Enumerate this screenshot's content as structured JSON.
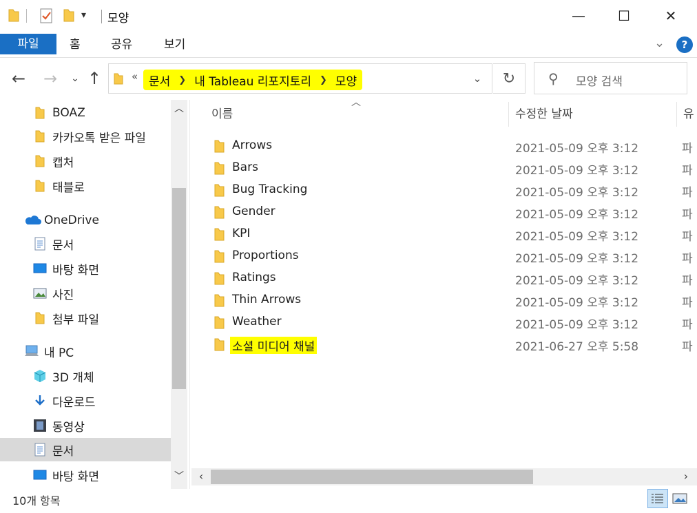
{
  "window": {
    "title": "모양",
    "minimize": "—",
    "maximize": "☐",
    "close": "✕"
  },
  "ribbon": {
    "tabs": [
      "파일",
      "홈",
      "공유",
      "보기"
    ]
  },
  "address": {
    "overflow": "«",
    "crumbs": [
      "문서",
      "내 Tableau 리포지토리",
      "모양"
    ]
  },
  "search": {
    "placeholder": "모양 검색"
  },
  "nav": {
    "items": [
      {
        "label": "BOAZ",
        "icon": "folder-icon"
      },
      {
        "label": "카카오톡 받은 파일",
        "icon": "folder-icon"
      },
      {
        "label": "캡처",
        "icon": "folder-icon"
      },
      {
        "label": "태블로",
        "icon": "folder-icon"
      },
      {
        "label": "OneDrive",
        "icon": "onedrive-cloud-icon"
      },
      {
        "label": "문서",
        "icon": "document-icon"
      },
      {
        "label": "바탕 화면",
        "icon": "desktop-icon"
      },
      {
        "label": "사진",
        "icon": "pictures-icon"
      },
      {
        "label": "첨부 파일",
        "icon": "folder-icon"
      },
      {
        "label": "내 PC",
        "icon": "this-pc-icon"
      },
      {
        "label": "3D 개체",
        "icon": "3d-objects-icon"
      },
      {
        "label": "다운로드",
        "icon": "download-icon"
      },
      {
        "label": "동영상",
        "icon": "videos-icon"
      },
      {
        "label": "문서",
        "icon": "document-icon",
        "selected": true
      },
      {
        "label": "바탕 화면",
        "icon": "desktop-icon"
      }
    ]
  },
  "columns": {
    "name": "이름",
    "modified": "수정한 날짜",
    "type": "유"
  },
  "files": [
    {
      "name": "Arrows",
      "modified": "2021-05-09 오후 3:12",
      "type": "파"
    },
    {
      "name": "Bars",
      "modified": "2021-05-09 오후 3:12",
      "type": "파"
    },
    {
      "name": "Bug Tracking",
      "modified": "2021-05-09 오후 3:12",
      "type": "파"
    },
    {
      "name": "Gender",
      "modified": "2021-05-09 오후 3:12",
      "type": "파"
    },
    {
      "name": "KPI",
      "modified": "2021-05-09 오후 3:12",
      "type": "파"
    },
    {
      "name": "Proportions",
      "modified": "2021-05-09 오후 3:12",
      "type": "파"
    },
    {
      "name": "Ratings",
      "modified": "2021-05-09 오후 3:12",
      "type": "파"
    },
    {
      "name": "Thin Arrows",
      "modified": "2021-05-09 오후 3:12",
      "type": "파"
    },
    {
      "name": "Weather",
      "modified": "2021-05-09 오후 3:12",
      "type": "파"
    },
    {
      "name": "소셜 미디어 채널",
      "modified": "2021-06-27 오후 5:58",
      "type": "파",
      "highlighted": true
    }
  ],
  "status": {
    "count": "10개 항목"
  },
  "colors": {
    "accent": "#1a6fc4",
    "highlight": "#ffff00",
    "folder": "#f8c94a"
  }
}
